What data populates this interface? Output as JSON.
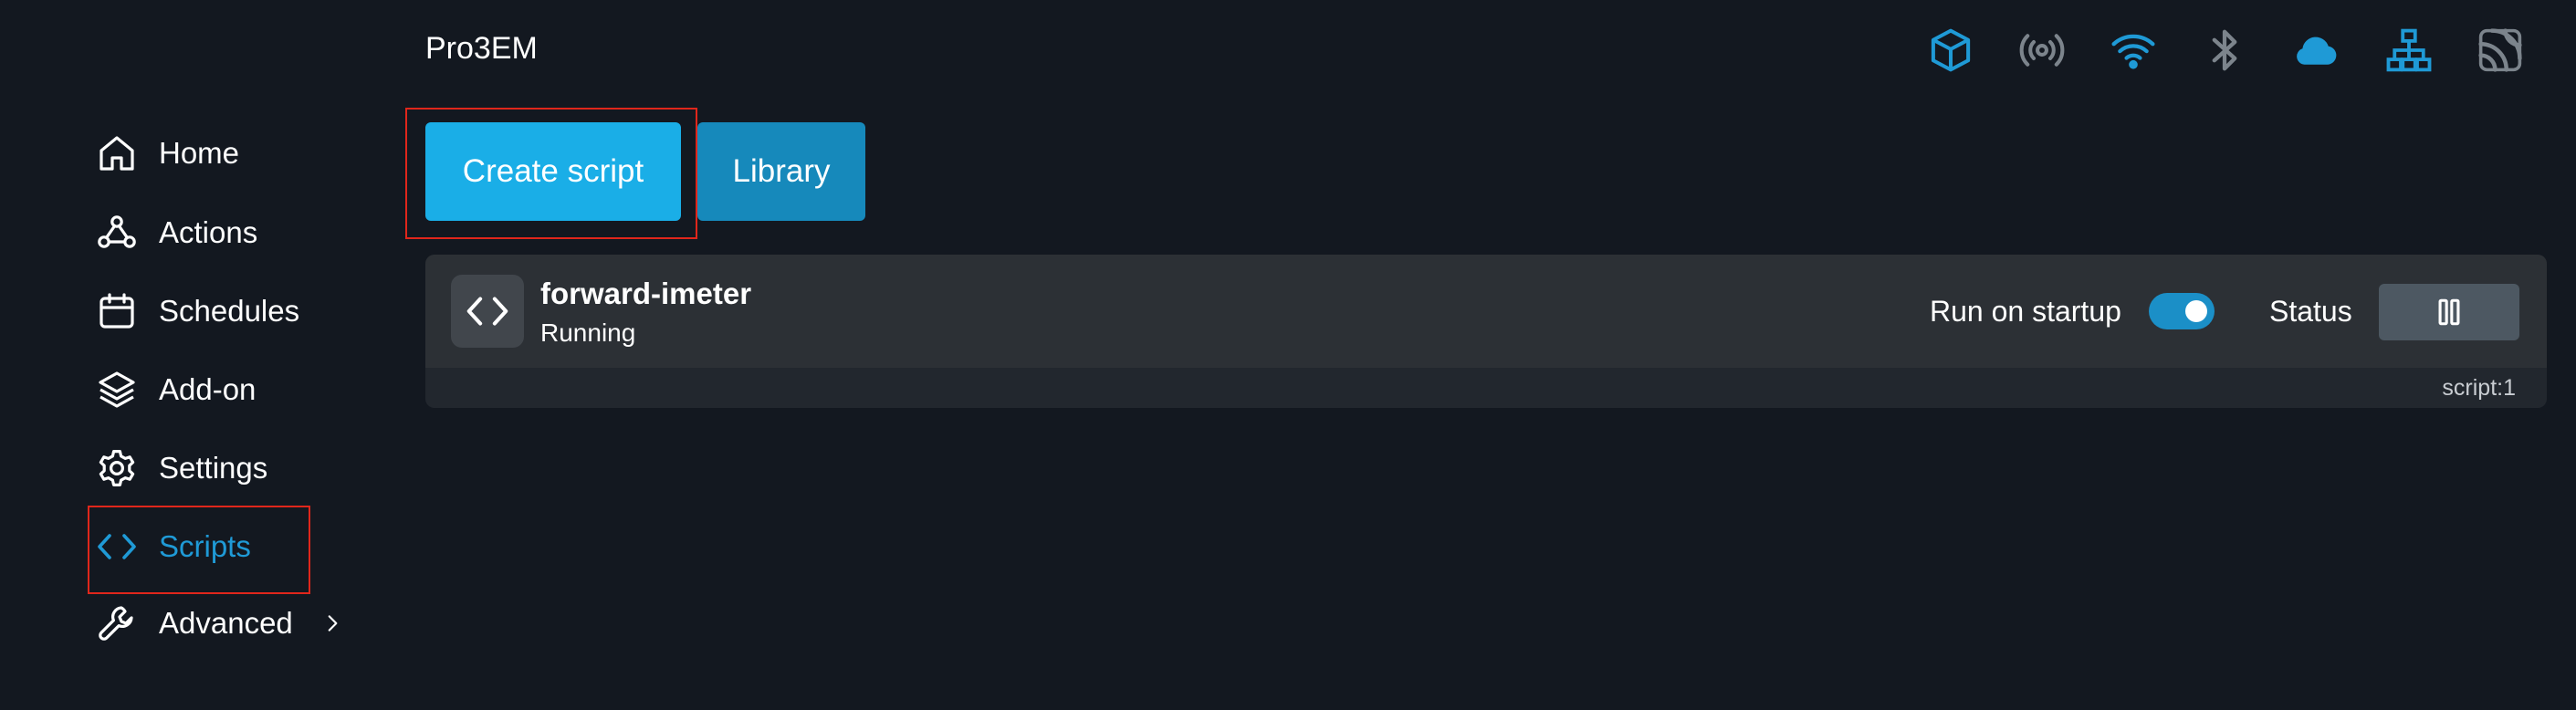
{
  "header": {
    "device_title": "Pro3EM",
    "status_icons": [
      {
        "name": "cube-icon",
        "color": "#1f9ad6"
      },
      {
        "name": "broadcast-icon",
        "color": "#7c848c"
      },
      {
        "name": "wifi-icon",
        "color": "#1f9ad6"
      },
      {
        "name": "bluetooth-icon",
        "color": "#7c848c"
      },
      {
        "name": "cloud-icon",
        "color": "#1f9ad6"
      },
      {
        "name": "ethernet-icon",
        "color": "#1f9ad6"
      },
      {
        "name": "mqtt-icon",
        "color": "#7c848c"
      }
    ]
  },
  "sidebar": {
    "items": [
      {
        "label": "Home",
        "icon": "home-icon",
        "active": false
      },
      {
        "label": "Actions",
        "icon": "actions-icon",
        "active": false
      },
      {
        "label": "Schedules",
        "icon": "calendar-icon",
        "active": false
      },
      {
        "label": "Add-on",
        "icon": "layers-icon",
        "active": false
      },
      {
        "label": "Settings",
        "icon": "gear-icon",
        "active": false
      },
      {
        "label": "Scripts",
        "icon": "code-icon",
        "active": true
      },
      {
        "label": "Advanced",
        "icon": "wrench-icon",
        "active": false,
        "has_submenu": true
      }
    ]
  },
  "toolbar": {
    "create_label": "Create script",
    "library_label": "Library"
  },
  "scripts": [
    {
      "name": "forward-imeter",
      "status": "Running",
      "run_on_startup_label": "Run on startup",
      "run_on_startup": true,
      "status_label": "Status",
      "id_label": "script:1"
    }
  ],
  "colors": {
    "accent": "#1f9ad6",
    "create_button": "#1aaee7",
    "library_button": "#1689bb",
    "highlight": "#e0261b",
    "background": "#131820"
  }
}
